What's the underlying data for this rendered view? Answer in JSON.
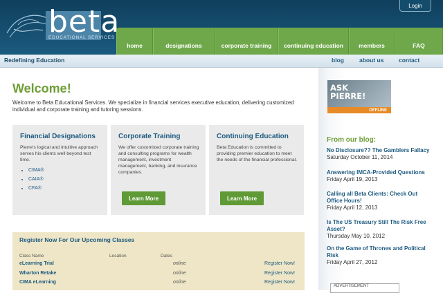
{
  "header": {
    "logo_text": "beta",
    "logo_sub": "EDUCATIONAL SERVICES",
    "login_label": "Login"
  },
  "main_nav": [
    "home",
    "designations",
    "corporate training",
    "continuing education",
    "members",
    "FAQ"
  ],
  "subbar": {
    "tagline": "Redefining Education",
    "links": [
      "blog",
      "about us",
      "contact"
    ]
  },
  "welcome": {
    "title": "Welcome!",
    "intro": "Welcome to Beta Educational Services. We specialize in financial services executive education, delivering customized individual and corporate training and tutoring sessions."
  },
  "cards": [
    {
      "title": "Financial Designations",
      "text": "Pierre's logical and intuitive approach serves his clients well beyond test time.",
      "list": [
        "CIMA®",
        "CAIA®",
        "CFA®"
      ]
    },
    {
      "title": "Corporate Training",
      "text": "We offer customized corporate training and consulting programs for wealth management, investment management, banking, and insurance companies.",
      "button": "Learn More"
    },
    {
      "title": "Continuing Education",
      "text": "Beta Education is committed to providing premier education to meet the needs of the financial professional.",
      "button": "Learn More"
    }
  ],
  "classes": {
    "title": "Register Now For Our Upcoming Classes",
    "headers": [
      "Class Name",
      "Location",
      "Dates"
    ],
    "rows": [
      {
        "name": "eLearning Trial",
        "location": "",
        "date": "online",
        "action": "Register Now!"
      },
      {
        "name": "Wharton Retake",
        "location": "",
        "date": "online",
        "action": "Register Now!"
      },
      {
        "name": "CIMA eLearning",
        "location": "",
        "date": "online",
        "action": "Register Now!"
      }
    ]
  },
  "sidebar": {
    "ask_line1": "ASK",
    "ask_line2": "PIERRE!",
    "ask_status": "OFFLINE",
    "blog_heading": "From our blog:",
    "posts": [
      {
        "title": "No Disclosure?? The Gamblers Fallacy",
        "date": "Saturday October 11, 2014"
      },
      {
        "title": "Answering IMCA-Provided Questions",
        "date": "Friday April 19, 2013"
      },
      {
        "title": "Calling all Beta Clients: Check Out Office Hours!",
        "date": "Friday April 12, 2013"
      },
      {
        "title": "Is The US Treasury Still The Risk Free Asset?",
        "date": "Thursday May 10, 2012"
      },
      {
        "title": "On the Game of Thrones and Political Risk",
        "date": "Friday April 27, 2012"
      }
    ],
    "advert_label": "ADVERTISEMENT"
  },
  "colors": {
    "header_blue": "#1b5b80",
    "nav_green": "#6fa84a",
    "accent_green": "#6d9e35",
    "link_blue": "#1d5a80",
    "offline_orange": "#e88a26"
  }
}
